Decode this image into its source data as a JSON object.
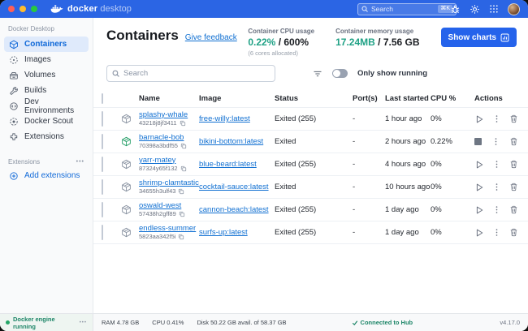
{
  "titlebar": {
    "app_name": "docker",
    "app_suffix": "desktop",
    "search_placeholder": "Search",
    "search_shortcut": "⌘K"
  },
  "sidebar": {
    "section_title": "Docker Desktop",
    "items": [
      {
        "label": "Containers",
        "selected": true
      },
      {
        "label": "Images"
      },
      {
        "label": "Volumes"
      },
      {
        "label": "Builds"
      },
      {
        "label": "Dev Environments"
      },
      {
        "label": "Docker Scout"
      },
      {
        "label": "Extensions"
      }
    ],
    "extensions_section": {
      "title": "Extensions",
      "menu": "•••",
      "add_label": "Add extensions"
    }
  },
  "header": {
    "title": "Containers",
    "feedback_link": "Give feedback",
    "cpu": {
      "label": "Container CPU usage",
      "value": "0.22%",
      "total": " / 600%",
      "note": "(6 cores allocated)"
    },
    "memory": {
      "label": "Container memory usage",
      "value": "17.24MB",
      "total": " / 7.56 GB"
    },
    "show_charts_label": "Show charts"
  },
  "toolbar": {
    "search_placeholder": "Search",
    "toggle_label": "Only show running"
  },
  "table": {
    "headers": {
      "name": "Name",
      "image": "Image",
      "status": "Status",
      "ports": "Port(s)",
      "last_started": "Last started",
      "cpu": "CPU %",
      "actions": "Actions"
    },
    "rows": [
      {
        "name": "splashy-whale",
        "id": "43218j8jf3411",
        "image": "free-willy:latest",
        "status": "Exited (255)",
        "ports": "-",
        "last_started": "1 hour ago",
        "cpu": "0%",
        "state": "exited"
      },
      {
        "name": "barnacle-bob",
        "id": "70398a3bdf55",
        "image": "bikini-bottom:latest",
        "status": "Exited",
        "ports": "-",
        "last_started": "2 hours ago",
        "cpu": "0.22%",
        "state": "running"
      },
      {
        "name": "yarr-matey",
        "id": "87324y65f132",
        "image": "blue-beard:latest",
        "status": "Exited (255)",
        "ports": "-",
        "last_started": "4 hours ago",
        "cpu": "0%",
        "state": "exited"
      },
      {
        "name": "shrimp-clamtastic",
        "id": "34655h3ulf43",
        "image": "cocktail-sauce:latest",
        "status": "Exited",
        "ports": "-",
        "last_started": "10 hours ago",
        "cpu": "0%",
        "state": "exited"
      },
      {
        "name": "oswald-west",
        "id": "57438h2gff89",
        "image": "cannon-beach:latest",
        "status": "Exited (255)",
        "ports": "-",
        "last_started": "1 day ago",
        "cpu": "0%",
        "state": "exited"
      },
      {
        "name": "endless-summer",
        "id": "5823aa342f5i",
        "image": "surfs-up:latest",
        "status": "Exited (255)",
        "ports": "-",
        "last_started": "1 day ago",
        "cpu": "0%",
        "state": "exited"
      }
    ]
  },
  "statusbar": {
    "engine": "Docker engine running",
    "engine_menu": "•••",
    "ram": "RAM 4.78 GB",
    "cpu": "CPU 0.41%",
    "disk": "Disk 50.22 GB avail. of 58.37 GB",
    "hub": "Connected to Hub",
    "version": "v4.17.0"
  },
  "colors": {
    "titlebar_blue": "#2b65e4",
    "accent_blue": "#2563eb",
    "link_blue": "#1170d2",
    "teal_value": "#1fa185",
    "engine_green": "#23a566",
    "running_icon_green": "#2aa06b"
  },
  "icons": {
    "logo": "docker-whale-icon",
    "top": [
      "troubleshoot-bug-icon",
      "settings-gear-icon",
      "apps-grid-icon",
      "avatar"
    ],
    "row_actions": [
      "play-icon|stop-icon",
      "row-menu-icon",
      "delete-trash-icon"
    ]
  }
}
